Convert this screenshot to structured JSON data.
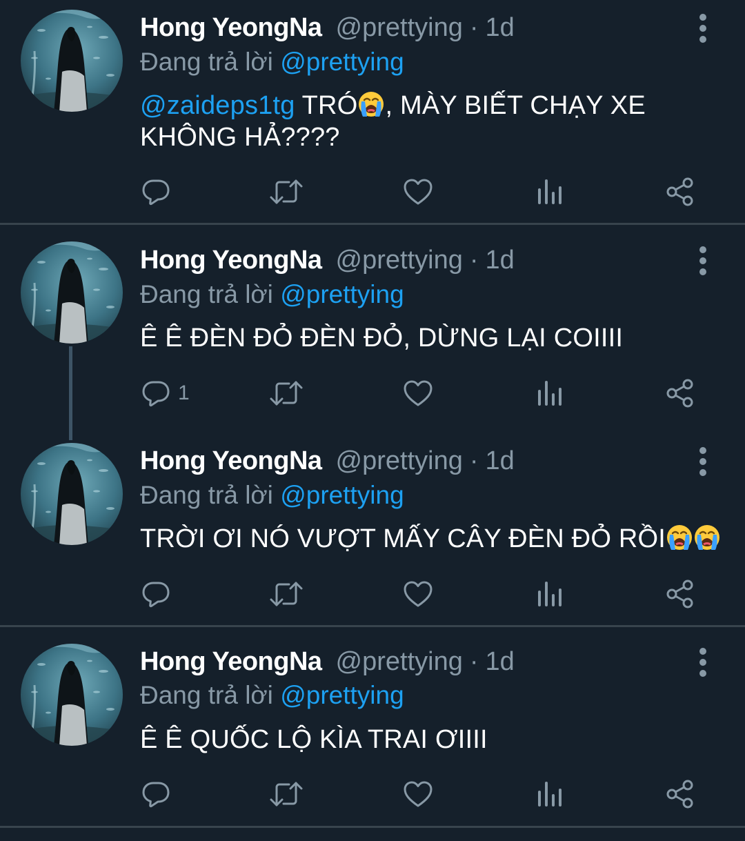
{
  "colors": {
    "background": "#15202b",
    "divider": "#38444d",
    "secondary_text": "#8899a6",
    "link": "#1da1f2"
  },
  "tweets": [
    {
      "author": {
        "name": "Hong YeongNa",
        "handle": "@prettying"
      },
      "separator": "·",
      "time": "1d",
      "replying_prefix": "Đang trả lời",
      "replying_to": "@prettying",
      "mention": "@zaideps1tg",
      "text_part1": " TRÓ",
      "emoji_1": "loudly-crying-face",
      "text_part2": ", MÀY BIẾT CHẠY XE KHÔNG HẢ????",
      "actions": {
        "reply": "reply-icon",
        "retweet": "retweet-icon",
        "like": "heart-icon",
        "analytics": "analytics-icon",
        "share": "share-icon"
      }
    },
    {
      "author": {
        "name": "Hong YeongNa",
        "handle": "@prettying"
      },
      "separator": "·",
      "time": "1d",
      "replying_prefix": "Đang trả lời",
      "replying_to": "@prettying",
      "text": "Ê Ê ĐÈN ĐỎ ĐÈN ĐỎ, DỪNG LẠI COIIII",
      "reply_count": "1",
      "actions": {
        "reply": "reply-icon",
        "retweet": "retweet-icon",
        "like": "heart-icon",
        "analytics": "analytics-icon",
        "share": "share-icon"
      }
    },
    {
      "author": {
        "name": "Hong YeongNa",
        "handle": "@prettying"
      },
      "separator": "·",
      "time": "1d",
      "replying_prefix": "Đang trả lời",
      "replying_to": "@prettying",
      "text": "TRỜI ƠI NÓ VƯỢT MẤY CÂY ĐÈN ĐỎ RỒI",
      "emoji_1": "loudly-crying-face",
      "emoji_2": "loudly-crying-face",
      "actions": {
        "reply": "reply-icon",
        "retweet": "retweet-icon",
        "like": "heart-icon",
        "analytics": "analytics-icon",
        "share": "share-icon"
      }
    },
    {
      "author": {
        "name": "Hong YeongNa",
        "handle": "@prettying"
      },
      "separator": "·",
      "time": "1d",
      "replying_prefix": "Đang trả lời",
      "replying_to": "@prettying",
      "text": "Ê Ê QUỐC LỘ KÌA TRAI ƠIIII",
      "actions": {
        "reply": "reply-icon",
        "retweet": "retweet-icon",
        "like": "heart-icon",
        "analytics": "analytics-icon",
        "share": "share-icon"
      }
    }
  ]
}
